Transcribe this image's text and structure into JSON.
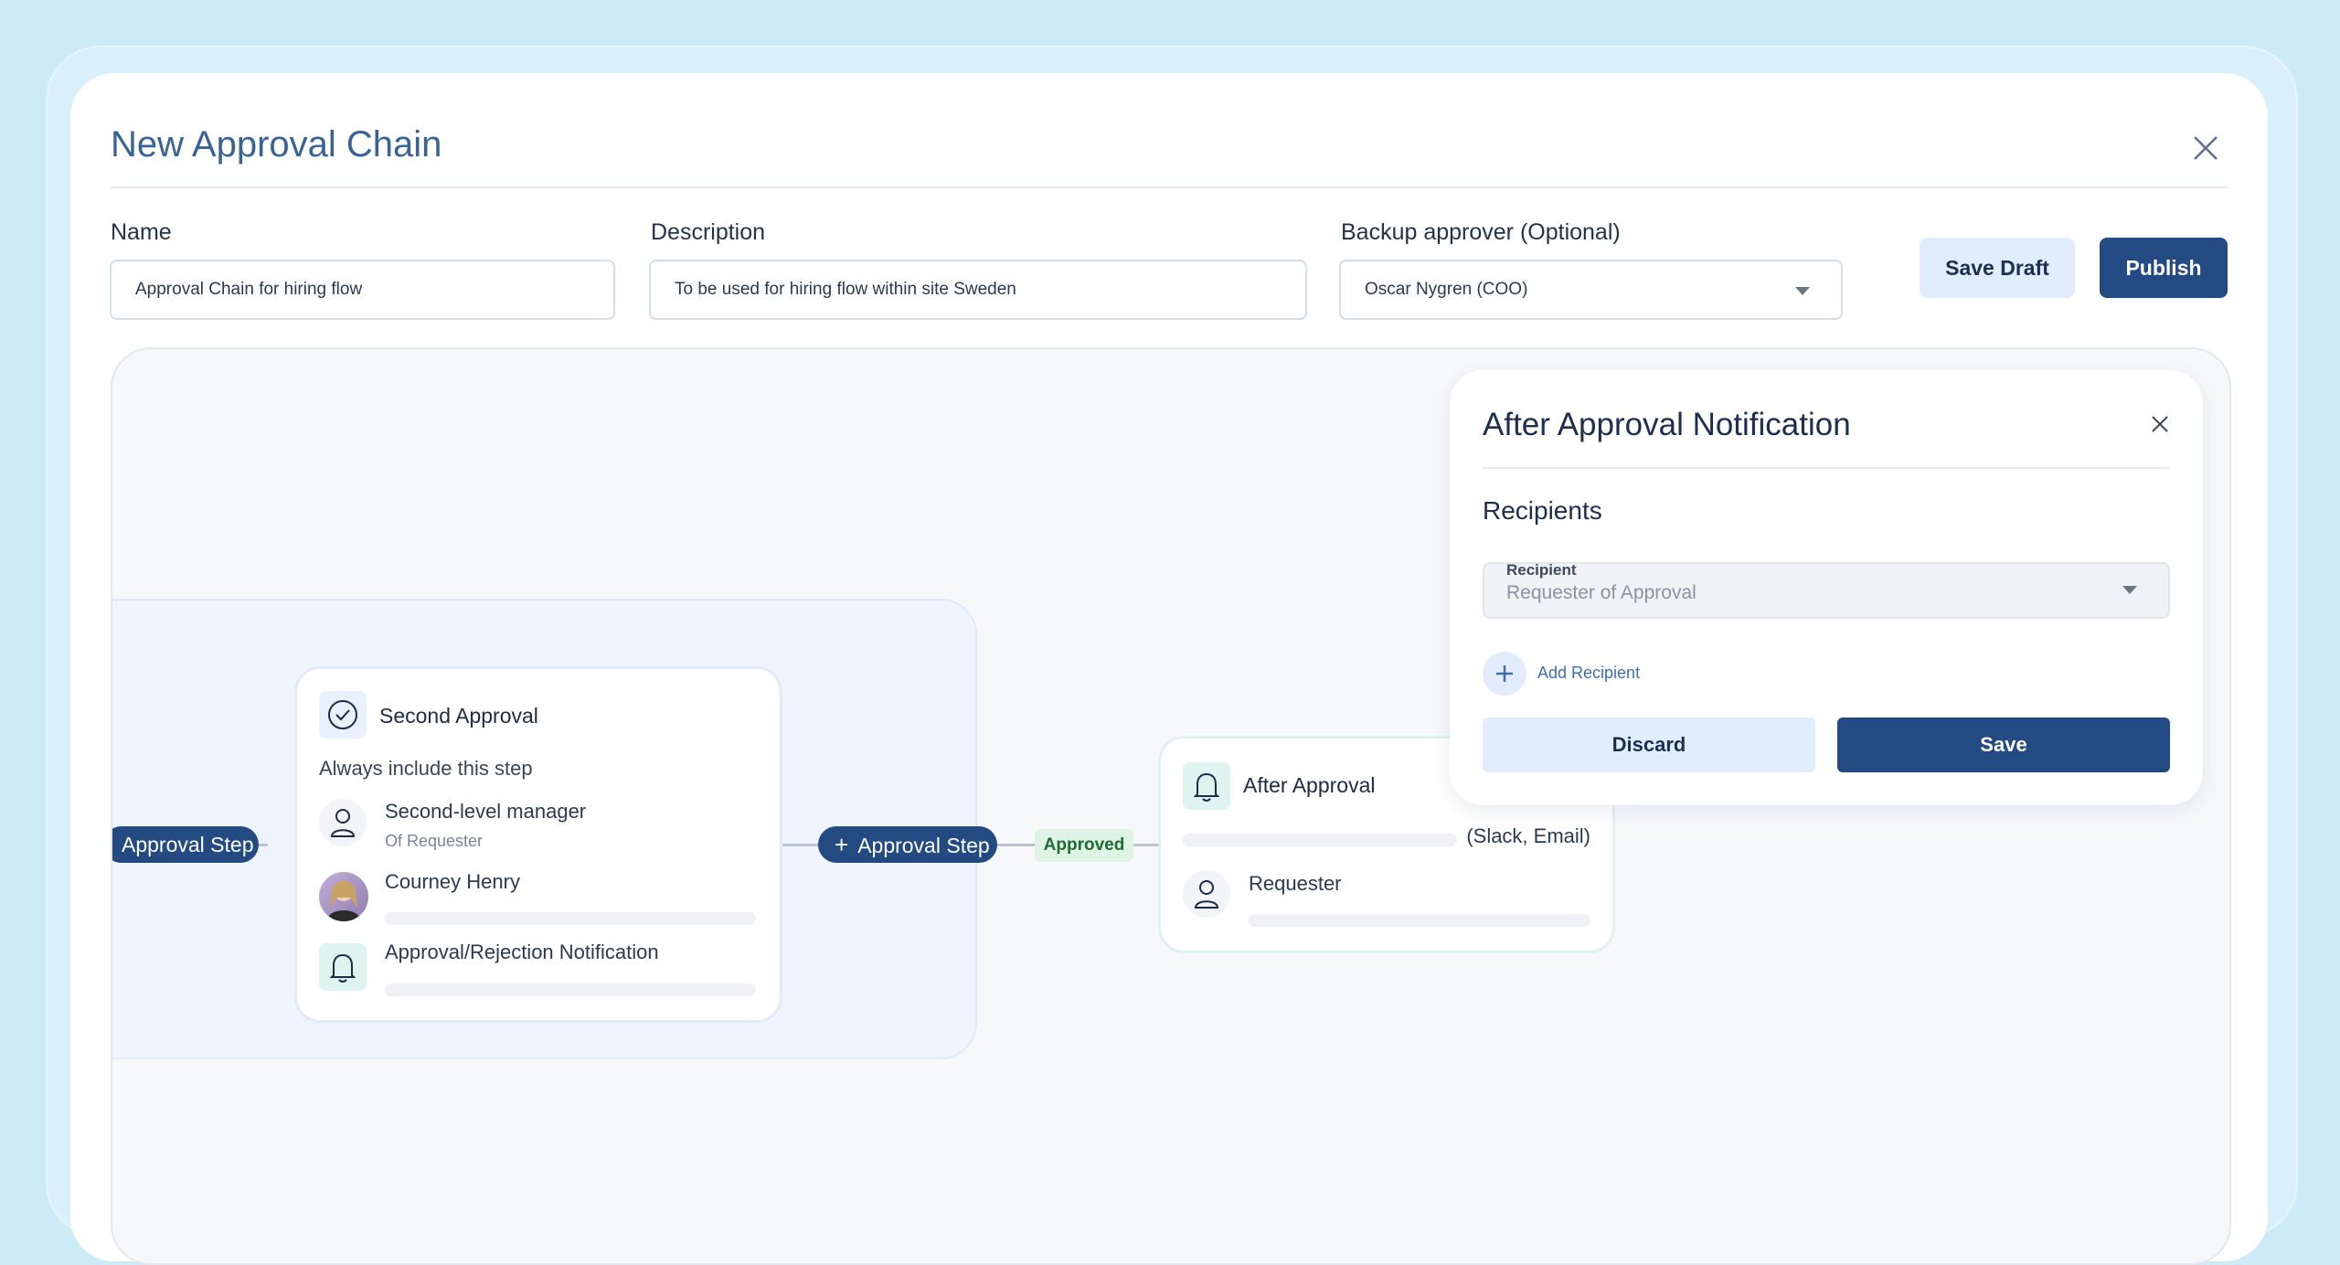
{
  "modal": {
    "title": "New Approval Chain",
    "fields": {
      "name": {
        "label": "Name",
        "value": "Approval Chain for hiring flow"
      },
      "description": {
        "label": "Description",
        "value": "To be used for hiring flow within site Sweden"
      },
      "backup": {
        "label": "Backup approver (Optional)",
        "value": "Oscar Nygren (COO)"
      }
    },
    "buttons": {
      "save_draft": "Save Draft",
      "publish": "Publish"
    }
  },
  "flow": {
    "left_pill": "Approval Step",
    "second_card": {
      "title": "Second Approval",
      "subtitle": "Always include this step",
      "approver_1": {
        "name": "Second-level manager",
        "sub": "Of Requester"
      },
      "approver_2": {
        "name": "Courney Henry"
      },
      "notification": {
        "name": "Approval/Rejection Notification"
      }
    },
    "add_pill": "Approval Step",
    "approved_badge": "Approved",
    "after_card": {
      "title": "After Approval",
      "channels": "(Slack, Email)",
      "recipient": "Requester"
    }
  },
  "panel": {
    "title": "After Approval Notification",
    "section": "Recipients",
    "recipient_label": "Recipient",
    "recipient_value": "Requester of Approval",
    "add_recipient": "Add Recipient",
    "discard": "Discard",
    "save": "Save"
  },
  "colors": {
    "primary": "#234a83",
    "light_primary": "#e1edfd",
    "background": "#cdeaf7",
    "approved": "#dff3e4"
  }
}
